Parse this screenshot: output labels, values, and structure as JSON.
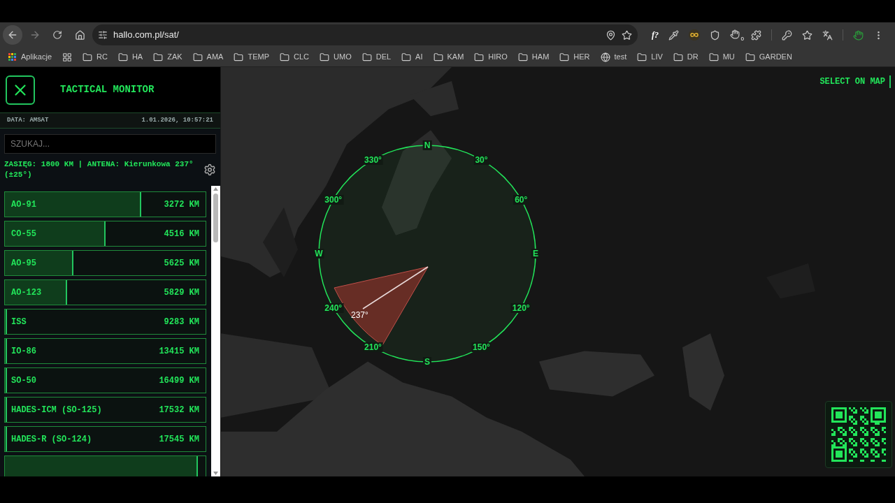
{
  "browser": {
    "url": "hallo.com.pl/sat/",
    "bookmarks": [
      {
        "kind": "apps",
        "label": "Aplikacje"
      },
      {
        "kind": "grid"
      },
      {
        "kind": "folder",
        "label": "RC"
      },
      {
        "kind": "folder",
        "label": "HA"
      },
      {
        "kind": "folder",
        "label": "ZAK"
      },
      {
        "kind": "folder",
        "label": "AMA"
      },
      {
        "kind": "folder",
        "label": "TEMP"
      },
      {
        "kind": "folder",
        "label": "CLC"
      },
      {
        "kind": "folder",
        "label": "UMO"
      },
      {
        "kind": "folder",
        "label": "DEL"
      },
      {
        "kind": "folder",
        "label": "AI"
      },
      {
        "kind": "folder",
        "label": "KAM"
      },
      {
        "kind": "folder",
        "label": "HIRO"
      },
      {
        "kind": "folder",
        "label": "HAM"
      },
      {
        "kind": "folder",
        "label": "HER"
      },
      {
        "kind": "site",
        "label": "test"
      },
      {
        "kind": "folder",
        "label": "LIV"
      },
      {
        "kind": "folder",
        "label": "DR"
      },
      {
        "kind": "folder",
        "label": "MU"
      },
      {
        "kind": "folder",
        "label": "GARDEN"
      }
    ],
    "extension_badge": "0",
    "function_label": "f?"
  },
  "sidebar": {
    "title": "TACTICAL MONITOR",
    "source": "DATA: AMSAT",
    "datetime": "1.01.2026, 10:57:21",
    "search": {
      "placeholder": "SZUKAJ..."
    },
    "status": "ZASIĘG: 1800 KM | ANTENA: Kierunkowa 237° (±25°)",
    "satellites": [
      {
        "name": "AO-91",
        "distance": "3272 KM",
        "level": 0.68
      },
      {
        "name": "CO-55",
        "distance": "4516 KM",
        "level": 0.5
      },
      {
        "name": "AO-95",
        "distance": "5625 KM",
        "level": 0.34
      },
      {
        "name": "AO-123",
        "distance": "5829 KM",
        "level": 0.31
      },
      {
        "name": "ISS",
        "distance": "9283 KM",
        "level": 0.01
      },
      {
        "name": "IO-86",
        "distance": "13415 KM",
        "level": 0.01
      },
      {
        "name": "SO-50",
        "distance": "16499 KM",
        "level": 0.01
      },
      {
        "name": "HADES-ICM (SO-125)",
        "distance": "17532 KM",
        "level": 0.01
      },
      {
        "name": "HADES-R (SO-124)",
        "distance": "17545 KM",
        "level": 0.01
      },
      {
        "level": 0.96
      }
    ]
  },
  "map": {
    "select_label": "SELECT ON MAP",
    "compass": [
      "N",
      "30°",
      "60°",
      "E",
      "120°",
      "150°",
      "S",
      "210°",
      "240°",
      "W",
      "300°",
      "330°"
    ],
    "heading": "237°"
  }
}
